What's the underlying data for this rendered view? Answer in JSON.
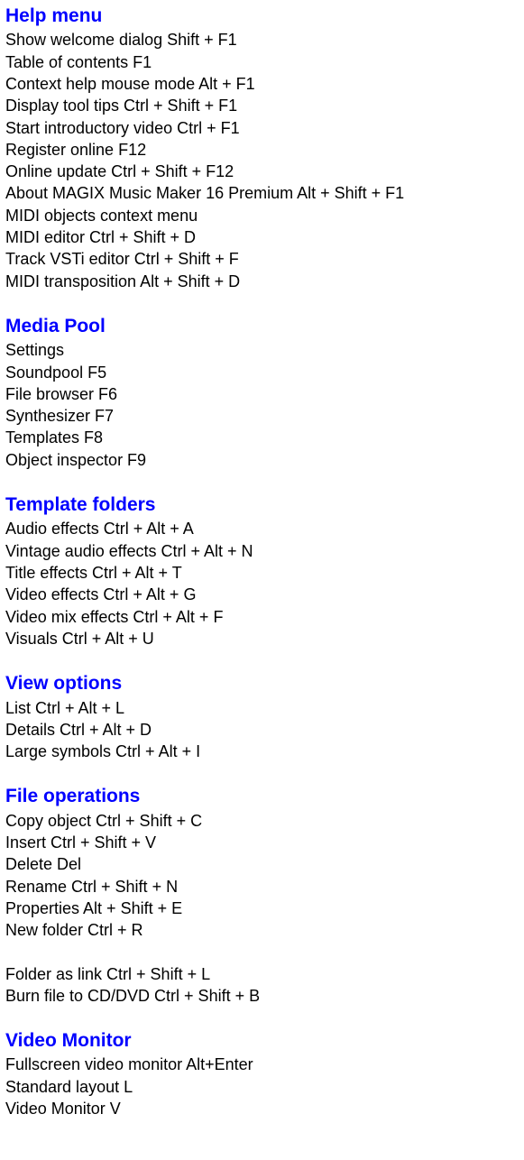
{
  "sections": [
    {
      "heading": "Help menu",
      "groups": [
        [
          "Show welcome dialog Shift + F1",
          "Table of contents F1",
          "Context help mouse mode Alt + F1",
          "Display tool tips Ctrl + Shift + F1",
          "Start introductory video Ctrl + F1",
          "Register online F12",
          "Online update Ctrl + Shift + F12",
          "About MAGIX Music Maker 16 Premium Alt + Shift + F1",
          "MIDI objects context menu",
          "MIDI editor Ctrl + Shift + D",
          "Track VSTi editor Ctrl + Shift + F",
          "MIDI transposition Alt + Shift + D"
        ]
      ]
    },
    {
      "heading": "Media Pool",
      "groups": [
        [
          "Settings",
          "Soundpool F5",
          "File browser F6",
          "Synthesizer F7",
          "Templates F8",
          "Object inspector F9"
        ]
      ]
    },
    {
      "heading": "Template folders",
      "groups": [
        [
          "Audio effects Ctrl + Alt + A",
          "Vintage audio effects Ctrl + Alt + N",
          "Title effects Ctrl + Alt + T",
          "Video effects Ctrl + Alt + G",
          "Video mix effects Ctrl + Alt + F",
          "Visuals Ctrl + Alt + U"
        ]
      ]
    },
    {
      "heading": "View options",
      "groups": [
        [
          "List Ctrl + Alt + L",
          "Details Ctrl + Alt + D",
          "Large symbols Ctrl + Alt + I"
        ]
      ]
    },
    {
      "heading": "File operations",
      "groups": [
        [
          "Copy object Ctrl + Shift + C",
          "Insert Ctrl + Shift + V",
          "Delete Del",
          "Rename Ctrl + Shift + N",
          "Properties Alt + Shift + E",
          "New folder Ctrl + R"
        ],
        [
          "Folder as link Ctrl + Shift + L",
          "Burn file to CD/DVD Ctrl + Shift + B"
        ]
      ]
    },
    {
      "heading": "Video Monitor",
      "groups": [
        [
          "Fullscreen video monitor Alt+Enter",
          "Standard layout L",
          "Video Monitor V"
        ]
      ]
    }
  ]
}
